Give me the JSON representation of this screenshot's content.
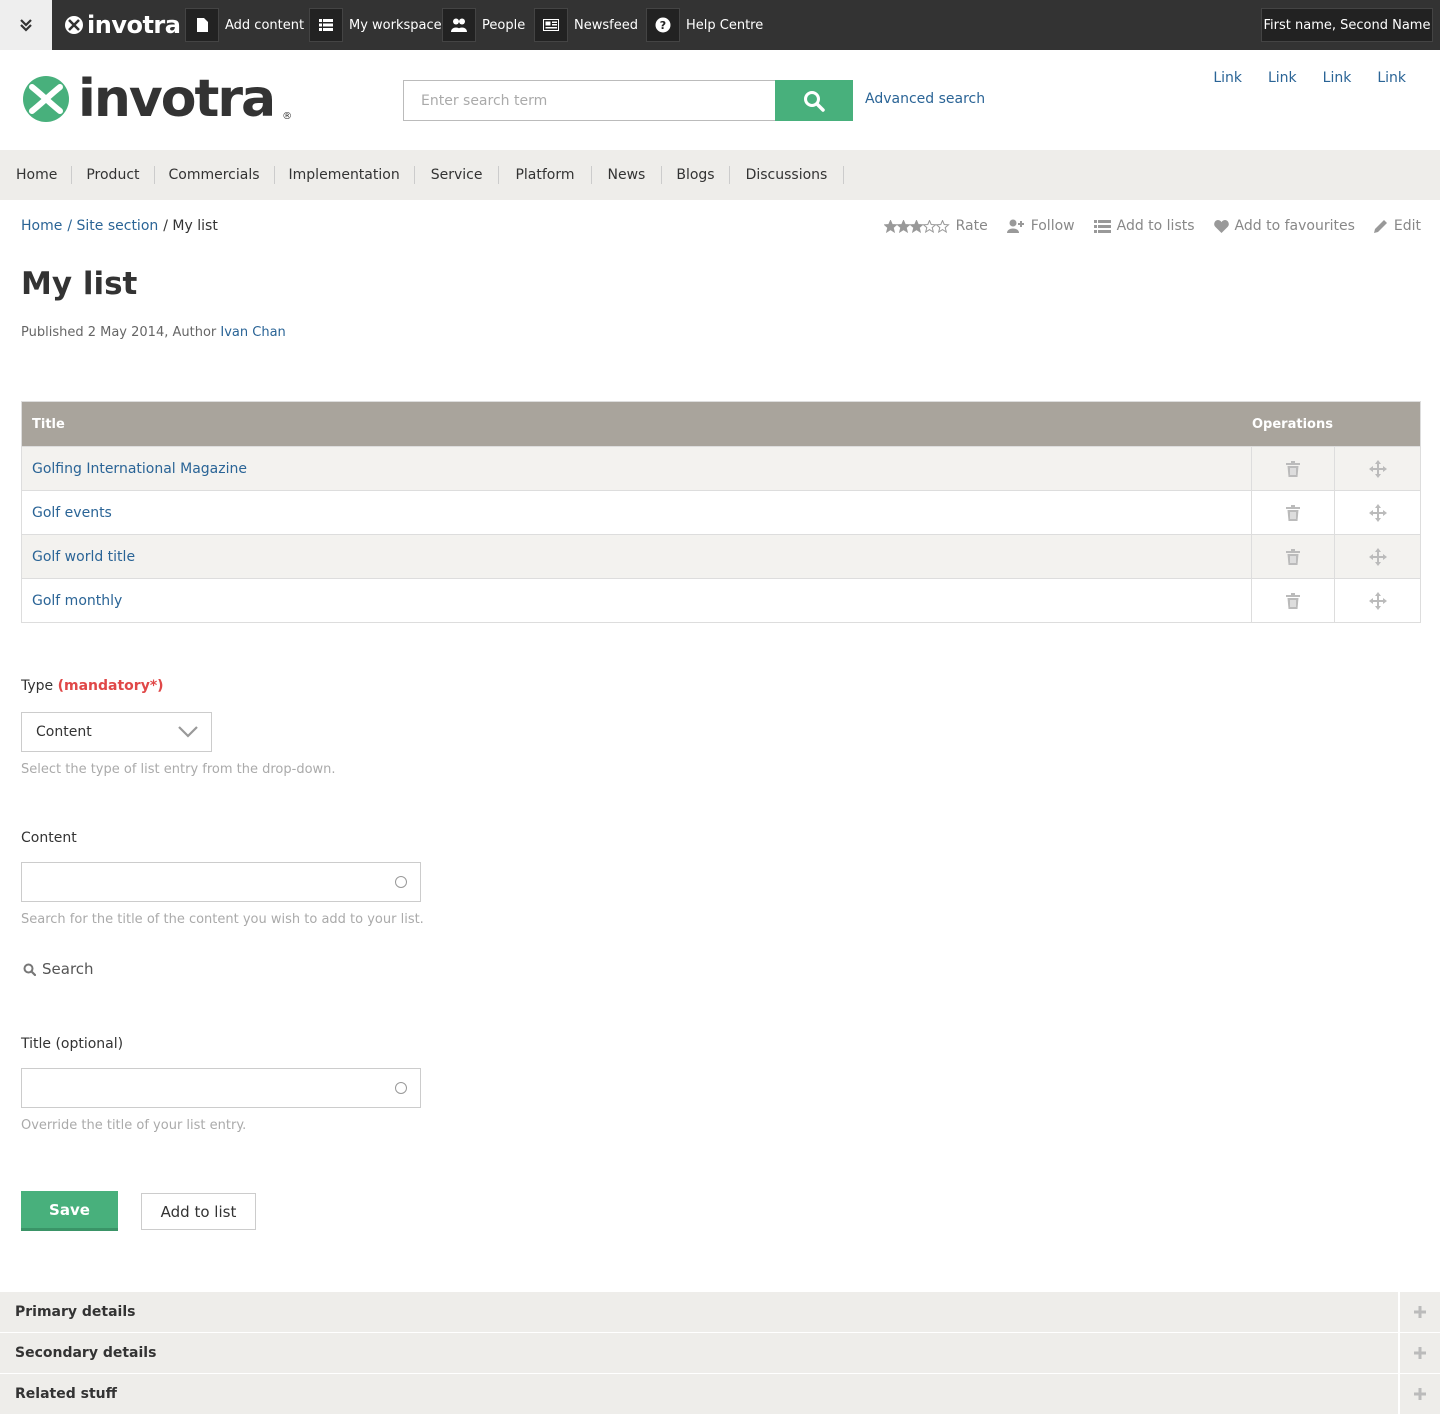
{
  "topbar": {
    "brand": "invotra",
    "items": [
      {
        "label": "Add content",
        "icon": "document-icon"
      },
      {
        "label": "My workspace",
        "icon": "list-icon"
      },
      {
        "label": "People",
        "icon": "people-icon"
      },
      {
        "label": "Newsfeed",
        "icon": "newspaper-icon"
      },
      {
        "label": "Help Centre",
        "icon": "help-icon"
      }
    ],
    "user": "First name, Second Name"
  },
  "header": {
    "logo_text": "invotra",
    "search_placeholder": "Enter search term",
    "advanced_search": "Advanced search",
    "links": [
      "Link",
      "Link",
      "Link",
      "Link"
    ]
  },
  "nav": [
    "Home",
    "Product",
    "Commercials",
    "Implementation",
    "Service",
    "Platform",
    "News",
    "Blogs",
    "Discussions"
  ],
  "breadcrumb": {
    "home": "Home",
    "section": "/ Site section",
    "current": "/ My list"
  },
  "actions": {
    "rate": "Rate",
    "follow": "Follow",
    "add_to_lists": "Add to lists",
    "favourites": "Add to favourites",
    "edit": "Edit"
  },
  "rating": {
    "value": 3,
    "max": 5
  },
  "page": {
    "title": "My list",
    "published": "Published 2 May 2014, Author",
    "author": "Ivan Chan"
  },
  "table": {
    "col_title": "Title",
    "col_ops": "Operations",
    "rows": [
      "Golfing International Magazine",
      "Golf events",
      "Golf world title",
      "Golf monthly"
    ]
  },
  "form": {
    "type_label": "Type",
    "type_mandatory": "(mandatory*)",
    "type_value": "Content",
    "type_help": "Select the type of list entry from the drop-down.",
    "content_label": "Content",
    "content_help": "Search for the title of the content you wish to add to your list.",
    "search_label": "Search",
    "title_label": "Title (optional)",
    "title_help": "Override the title of your list entry.",
    "save": "Save",
    "add_to_list": "Add to list"
  },
  "accordion": [
    "Primary details",
    "Secondary details",
    "Related stuff"
  ],
  "colors": {
    "accent": "#48b07c",
    "link": "#2a6496",
    "topbar": "#333333",
    "table_header": "#a9a49c"
  }
}
